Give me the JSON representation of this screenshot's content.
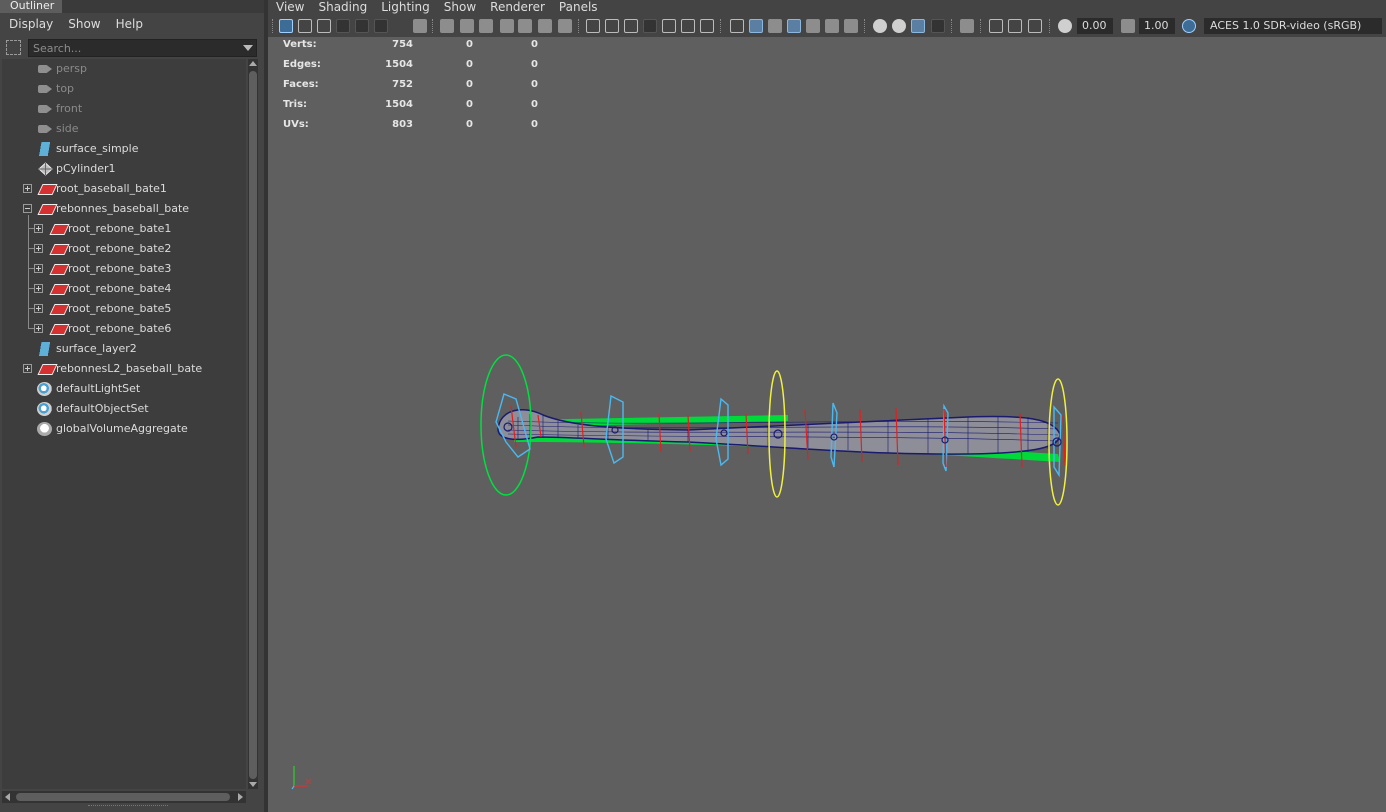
{
  "outliner": {
    "tab_title": "Outliner",
    "menu": [
      "Display",
      "Show",
      "Help"
    ],
    "search_placeholder": "Search...",
    "items": [
      {
        "label": "persp",
        "icon": "camera-icon",
        "dim": true
      },
      {
        "label": "top",
        "icon": "camera-icon",
        "dim": true
      },
      {
        "label": "front",
        "icon": "camera-icon",
        "dim": true
      },
      {
        "label": "side",
        "icon": "camera-icon",
        "dim": true
      },
      {
        "label": "surface_simple",
        "icon": "nurbs-surface-icon"
      },
      {
        "label": "pCylinder1",
        "icon": "poly-mesh-icon"
      },
      {
        "label": "root_baseball_bate1",
        "icon": "joint-icon"
      },
      {
        "label": "rebonnes_baseball_bate",
        "icon": "joint-icon"
      },
      {
        "label": "root_rebone_bate1",
        "icon": "joint-icon"
      },
      {
        "label": "root_rebone_bate2",
        "icon": "joint-icon"
      },
      {
        "label": "root_rebone_bate3",
        "icon": "joint-icon"
      },
      {
        "label": "root_rebone_bate4",
        "icon": "joint-icon"
      },
      {
        "label": "root_rebone_bate5",
        "icon": "joint-icon"
      },
      {
        "label": "root_rebone_bate6",
        "icon": "joint-icon"
      },
      {
        "label": "surface_layer2",
        "icon": "nurbs-surface-icon"
      },
      {
        "label": "rebonnesL2_baseball_bate",
        "icon": "joint-icon"
      },
      {
        "label": "defaultLightSet",
        "icon": "object-set-icon"
      },
      {
        "label": "defaultObjectSet",
        "icon": "object-set-icon"
      },
      {
        "label": "globalVolumeAggregate",
        "icon": "volume-aggregate-icon"
      }
    ]
  },
  "viewport": {
    "menu": [
      "View",
      "Shading",
      "Lighting",
      "Show",
      "Renderer",
      "Panels"
    ],
    "exposure": "0.00",
    "gamma": "1.00",
    "color_space": "ACES 1.0 SDR-video (sRGB)",
    "hud": {
      "rows": [
        {
          "label": "Verts:",
          "v1": "754",
          "v2": "0",
          "v3": "0"
        },
        {
          "label": "Edges:",
          "v1": "1504",
          "v2": "0",
          "v3": "0"
        },
        {
          "label": "Faces:",
          "v1": "752",
          "v2": "0",
          "v3": "0"
        },
        {
          "label": "Tris:",
          "v1": "1504",
          "v2": "0",
          "v3": "0"
        },
        {
          "label": "UVs:",
          "v1": "803",
          "v2": "0",
          "v3": "0"
        }
      ]
    },
    "colors": {
      "background": "#5f5f5f",
      "mesh_wire": "#1a1a6e",
      "mesh_fill": "#8e8e99",
      "curve_green": "#00e040",
      "control_red": "#e02020",
      "control_cyan": "#4cb8f0",
      "control_yellow": "#f0f040",
      "axis_x": "#e03030",
      "axis_y": "#30d030"
    }
  }
}
